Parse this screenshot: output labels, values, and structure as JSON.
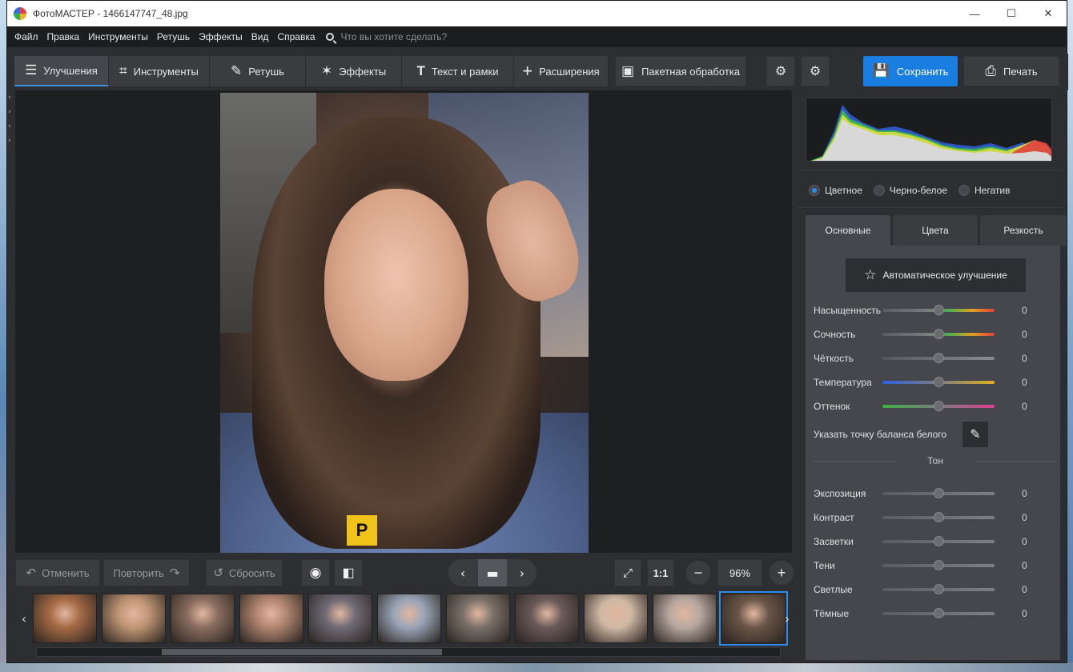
{
  "window": {
    "title": "ФотоМАСТЕР - 1466147747_48.jpg",
    "controls": [
      "—",
      "☐",
      "✕"
    ]
  },
  "menu": {
    "items": [
      "Файл",
      "Правка",
      "Инструменты",
      "Ретушь",
      "Эффекты",
      "Вид",
      "Справка"
    ],
    "search_placeholder": "Что вы хотите сделать?"
  },
  "toolbar": {
    "tabs": [
      {
        "label": "Улучшения",
        "icon": "sliders-icon",
        "glyph": "☰"
      },
      {
        "label": "Инструменты",
        "icon": "crop-icon",
        "glyph": "⌗"
      },
      {
        "label": "Ретушь",
        "icon": "brush-icon",
        "glyph": "✎"
      },
      {
        "label": "Эффекты",
        "icon": "magic-wand-icon",
        "glyph": "✶"
      },
      {
        "label": "Текст и рамки",
        "icon": "text-icon",
        "glyph": "T"
      },
      {
        "label": "Расширения",
        "icon": "plus-icon",
        "glyph": "+"
      }
    ],
    "batch_label": "Пакетная обработка",
    "save_label": "Сохранить",
    "print_label": "Печать"
  },
  "viewer": {
    "badge": "P"
  },
  "controls": {
    "undo_label": "Отменить",
    "redo_label": "Повторить",
    "reset_label": "Сбросить",
    "zoom_fit_label": "1:1",
    "zoom_value": "96%"
  },
  "panel": {
    "modes": [
      "Цветное",
      "Черно-белое",
      "Негатив"
    ],
    "subtabs": [
      "Основные",
      "Цвета",
      "Резкость"
    ],
    "auto_label": "Автоматическое улучшение",
    "sliders": [
      {
        "label": "Насыщенность",
        "value": "0",
        "gradient": "linear-gradient(90deg,#5a5c61,#7a7c80 40%,#4caf50 60%,#e0a020 80%,#e04040)"
      },
      {
        "label": "Сочность",
        "value": "0",
        "gradient": "linear-gradient(90deg,#5a5c61,#7a7c80 40%,#4caf50 60%,#e0a020 80%,#e04040)"
      },
      {
        "label": "Чёткость",
        "value": "0",
        "gradient": "linear-gradient(90deg,#55575c,#8a8c90)"
      },
      {
        "label": "Температура",
        "value": "0",
        "gradient": "linear-gradient(90deg,#3060e0,#7a7c80 50%,#e0b020)"
      },
      {
        "label": "Оттенок",
        "value": "0",
        "gradient": "linear-gradient(90deg,#40b040,#7a7c80 50%,#e04090)"
      }
    ],
    "white_balance_label": "Указать точку баланса белого",
    "tone_header": "Тон",
    "tone_sliders": [
      {
        "label": "Экспозиция",
        "value": "0"
      },
      {
        "label": "Контраст",
        "value": "0"
      },
      {
        "label": "Засветки",
        "value": "0"
      },
      {
        "label": "Тени",
        "value": "0"
      },
      {
        "label": "Светлые",
        "value": "0"
      },
      {
        "label": "Тёмные",
        "value": "0"
      }
    ]
  },
  "filmstrip": {
    "thumbs": [
      "#a56a45",
      "#c09575",
      "#8a6d60",
      "#b18570",
      "#6f6a75",
      "#9aa5b8",
      "#7a7068",
      "#6a5a58",
      "#d0b8a5",
      "#b8a8a0",
      "#6a5548"
    ],
    "selected_index": 10
  }
}
